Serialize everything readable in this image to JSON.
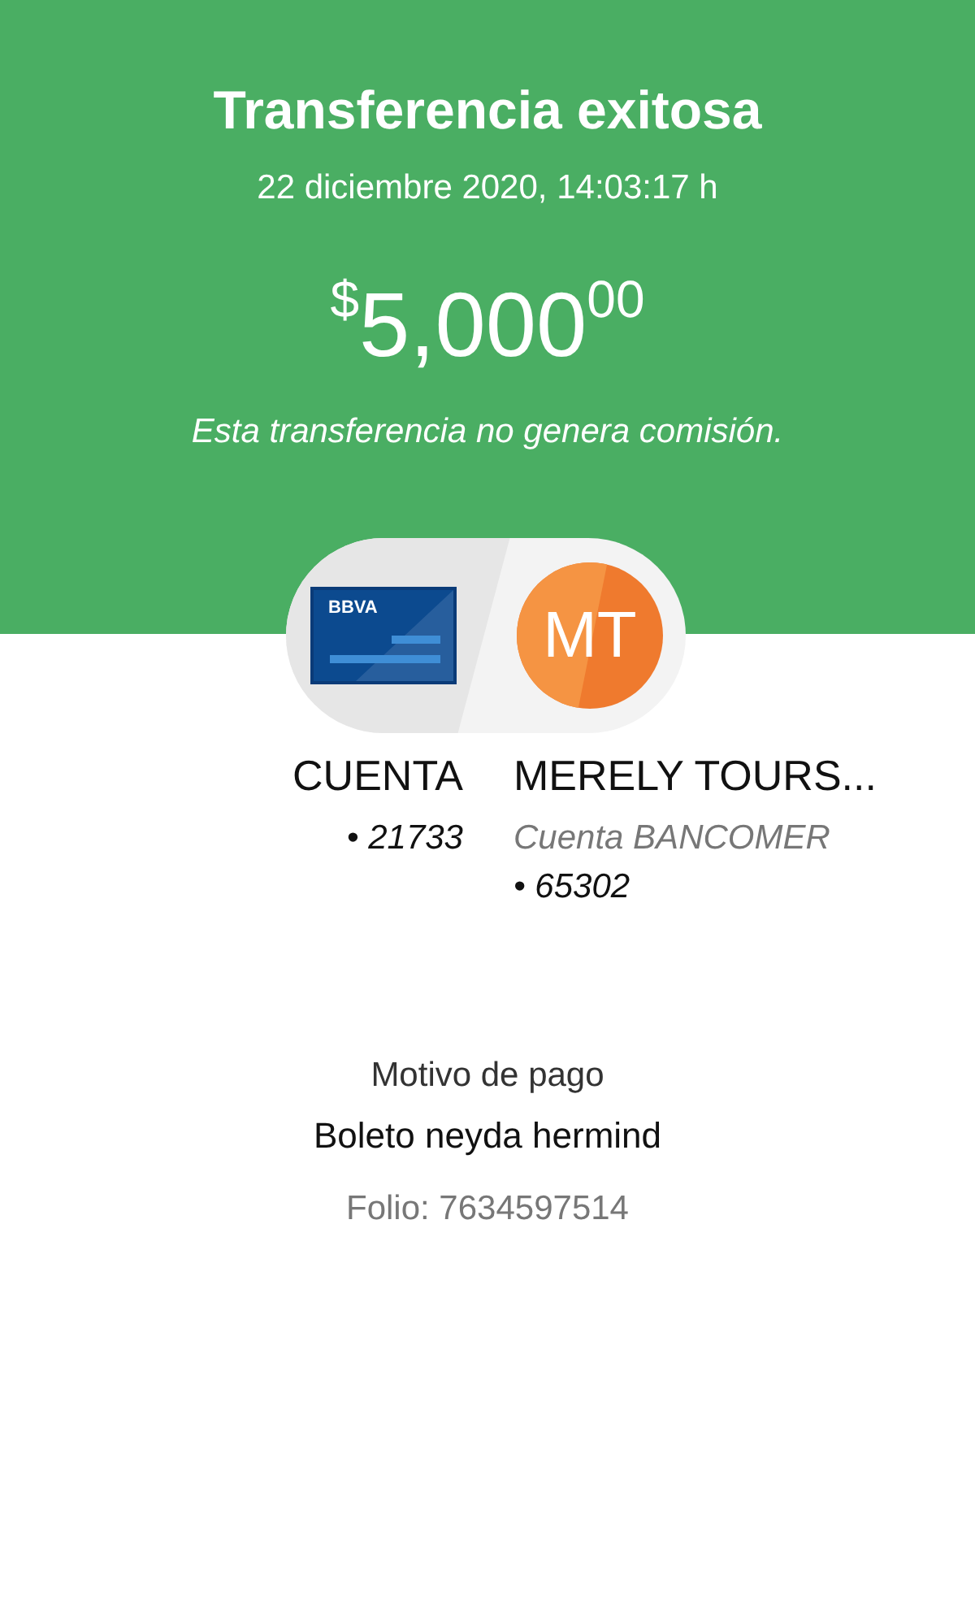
{
  "header": {
    "title": "Transferencia exitosa",
    "datetime": "22 diciembre 2020, 14:03:17 h",
    "amount": {
      "currency": "$",
      "whole": "5,000",
      "cents": "00"
    },
    "note": "Esta transferencia no genera comisión."
  },
  "origin": {
    "card_brand": "BBVA",
    "name": "CUENTA",
    "account": "• 21733"
  },
  "destination": {
    "initials": "MT",
    "name": "MERELY TOURS...",
    "bank": "Cuenta BANCOMER",
    "account": "• 65302"
  },
  "details": {
    "label": "Motivo de pago",
    "value": "Boleto neyda hermind",
    "folio": "Folio: 7634597514"
  }
}
